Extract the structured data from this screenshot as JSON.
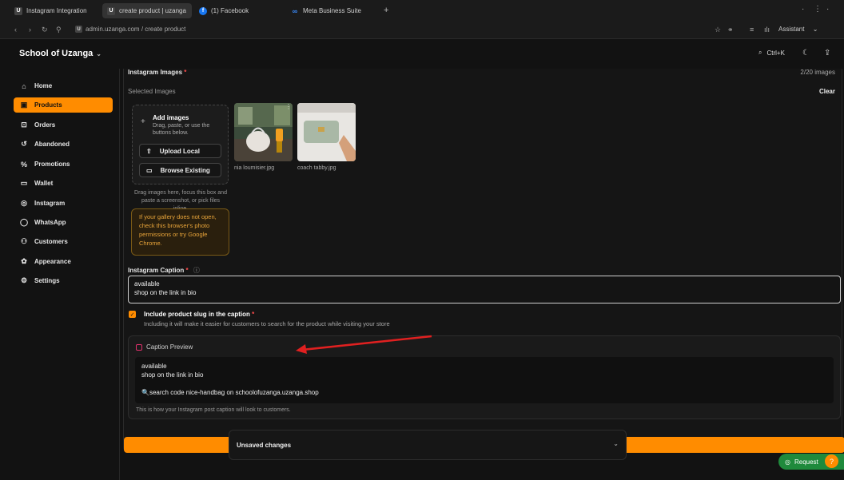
{
  "browser": {
    "tabs": [
      {
        "label": "Instagram Integration",
        "icon": "uzanga-favicon"
      },
      {
        "label": "create product | uzanga",
        "icon": "uzanga-favicon"
      },
      {
        "label": "(1) Facebook",
        "icon": "facebook-icon"
      },
      {
        "label": "Meta Business Suite",
        "icon": "meta-icon"
      }
    ],
    "url": "admin.uzanga.com / create product",
    "assistant_label": "Assistant"
  },
  "header": {
    "brand": "School of Uzanga",
    "search_shortcut": "Ctrl+K"
  },
  "sidebar": {
    "items": [
      {
        "label": "Home",
        "icon": "home-icon"
      },
      {
        "label": "Products",
        "icon": "box-icon",
        "active": true
      },
      {
        "label": "Orders",
        "icon": "cart-icon"
      },
      {
        "label": "Abandoned",
        "icon": "refresh-icon"
      },
      {
        "label": "Promotions",
        "icon": "percent-icon"
      },
      {
        "label": "Wallet",
        "icon": "wallet-icon"
      },
      {
        "label": "Instagram",
        "icon": "instagram-icon"
      },
      {
        "label": "WhatsApp",
        "icon": "whatsapp-icon"
      },
      {
        "label": "Customers",
        "icon": "users-icon"
      },
      {
        "label": "Appearance",
        "icon": "palette-icon"
      },
      {
        "label": "Settings",
        "icon": "gear-icon"
      }
    ]
  },
  "instagram_images": {
    "title": "Instagram Images",
    "required": "*",
    "count": "2/20 images",
    "selected_label": "Selected Images",
    "clear_label": "Clear",
    "add_title": "Add images",
    "add_subtitle": "Drag, paste, or use the buttons below.",
    "upload_label": "Upload Local",
    "browse_label": "Browse Existing",
    "drag_hint": "Drag images here, focus this box and paste a screenshot, or pick files inline.",
    "warning": "If your gallery does not open, check this browser's photo permissions or try Google Chrome.",
    "files": [
      {
        "name": "nia loumisier.jpg"
      },
      {
        "name": "coach tabby.jpg"
      }
    ]
  },
  "caption": {
    "label": "Instagram Caption",
    "required": "*",
    "line1": "available",
    "line2": "shop on the link in bio",
    "include_slug_label": "Include product slug in the caption",
    "include_slug_required": "*",
    "include_slug_help": "Including it will make it easier for customers to search for the product while visiting your store"
  },
  "preview": {
    "title": "Caption Preview",
    "line1": "available",
    "line2": "shop on the link in bio",
    "line3": "🔍search code nice-handbag on schoolofuzanga.uzanga.shop",
    "note": "This is how your Instagram post caption will look to customers."
  },
  "footer": {
    "unsaved": "Unsaved changes",
    "request_label": "Request"
  },
  "colors": {
    "accent": "#ff8c00",
    "annotation_arrow": "#e02020",
    "whatsapp_green": "#1f8a3c"
  }
}
